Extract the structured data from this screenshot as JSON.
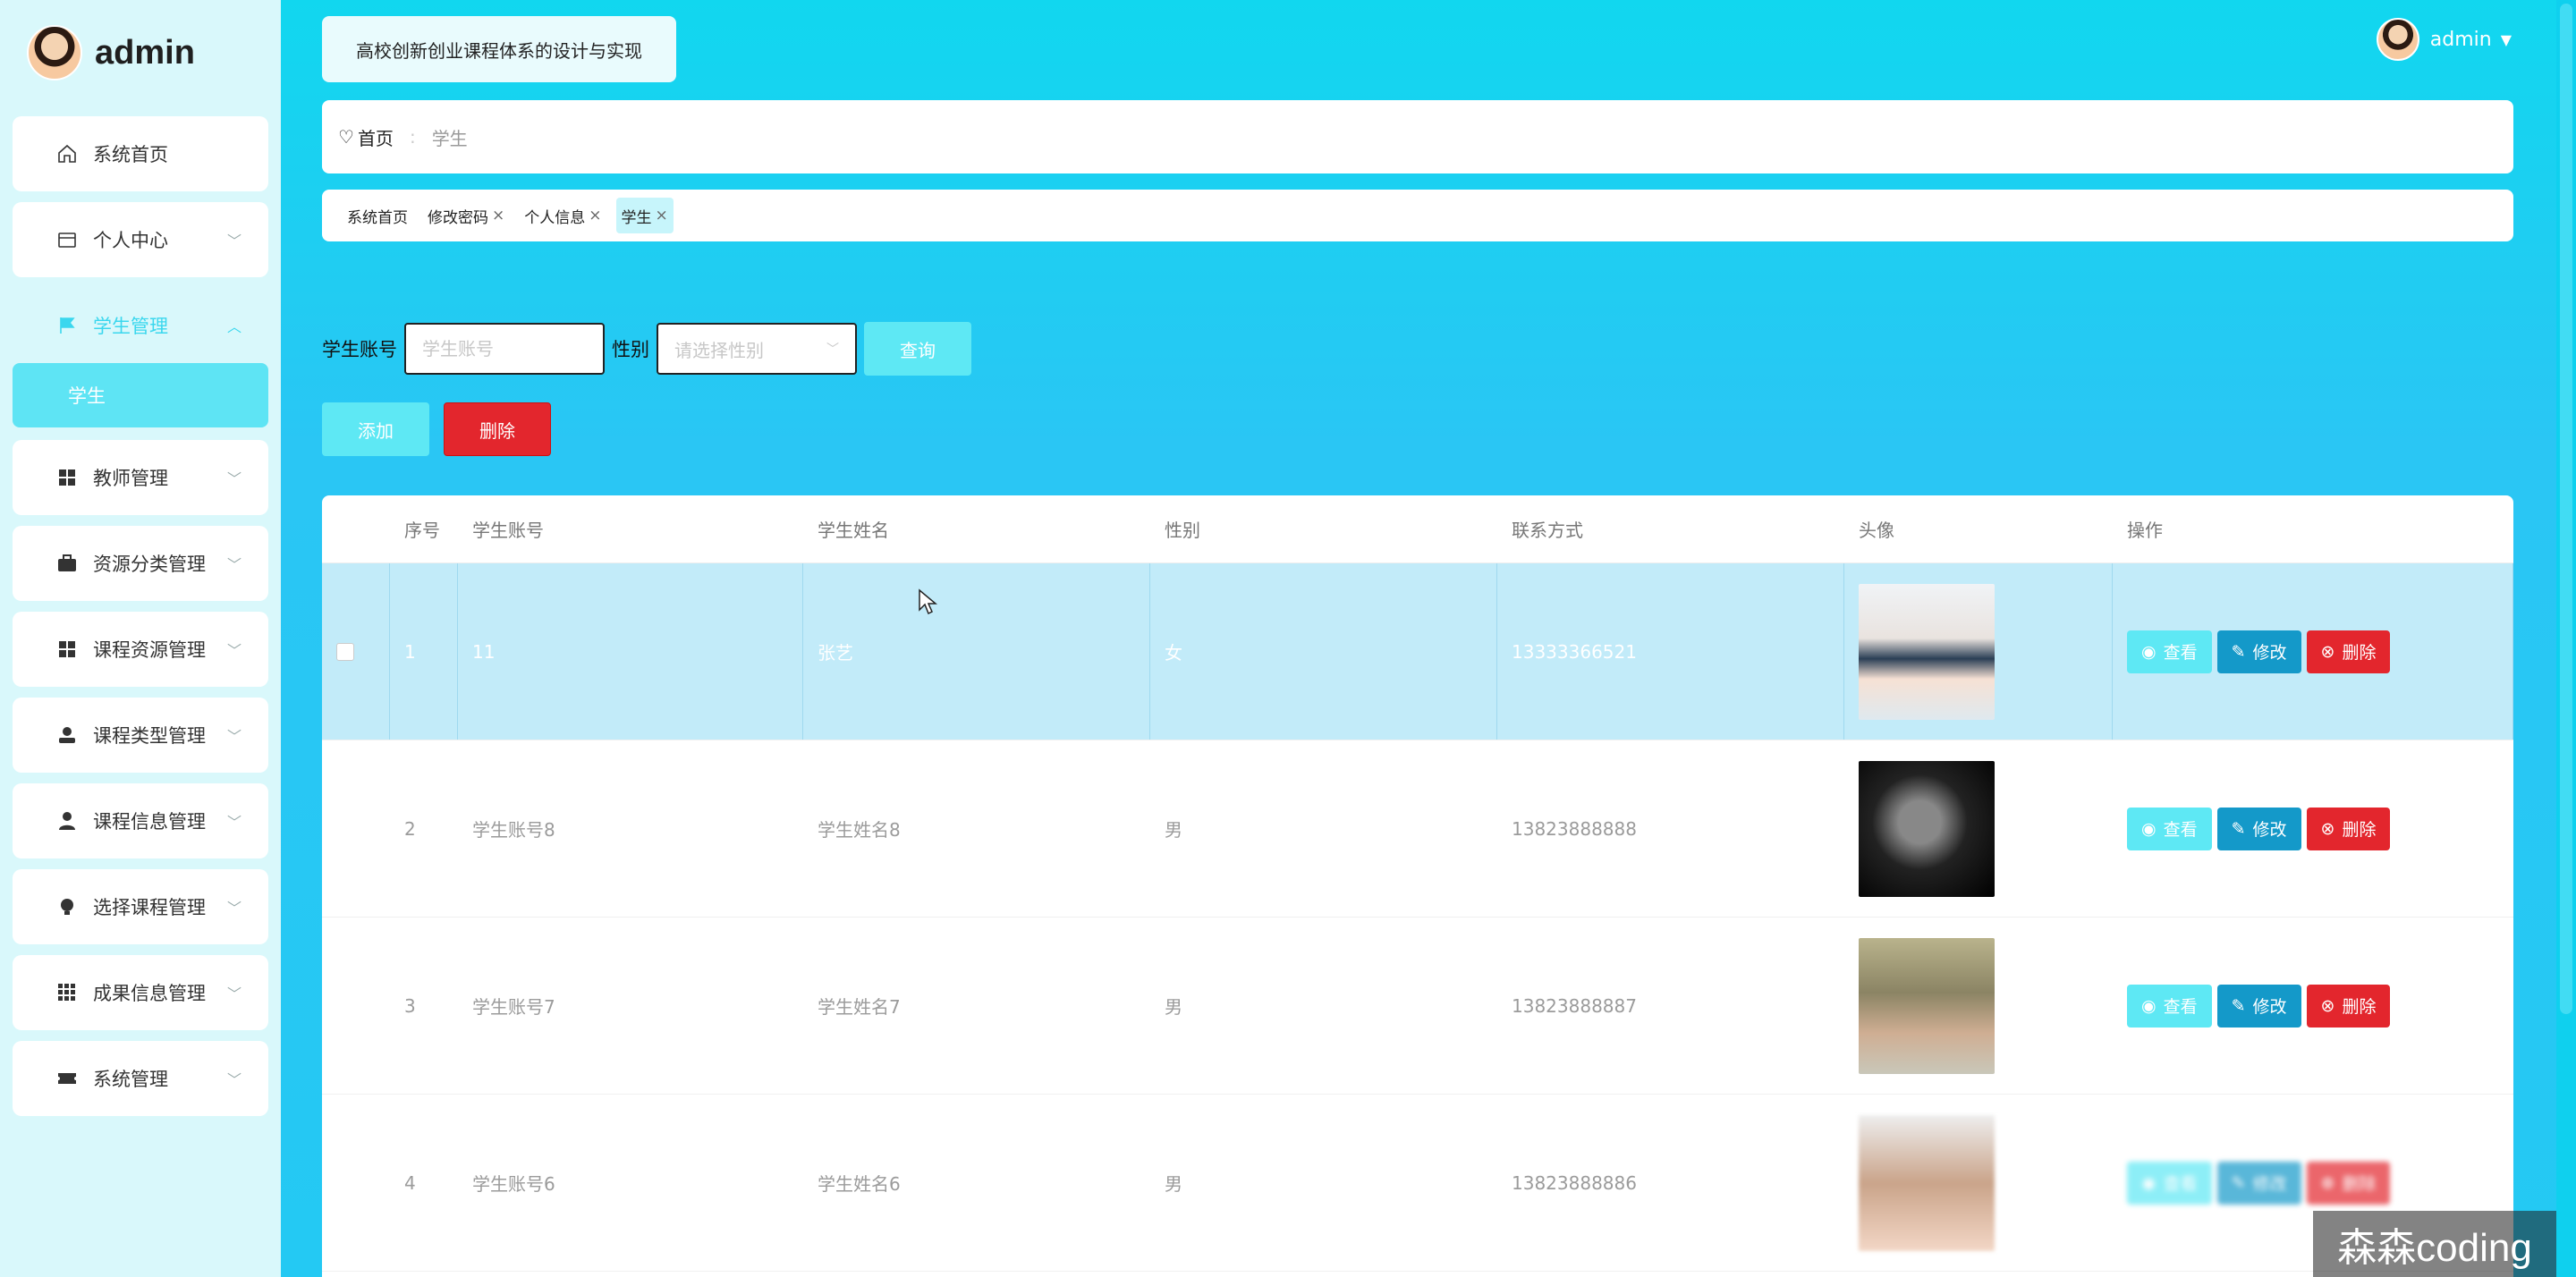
{
  "brand": {
    "name": "admin"
  },
  "sidebar": {
    "items": [
      {
        "label": "系统首页",
        "icon": "home-icon",
        "has_chevron": false
      },
      {
        "label": "个人中心",
        "icon": "calendar-icon",
        "has_chevron": true
      },
      {
        "label": "学生管理",
        "icon": "flag-icon",
        "has_chevron": true,
        "active": true
      },
      {
        "label": "教师管理",
        "icon": "grid-icon",
        "has_chevron": true
      },
      {
        "label": "资源分类管理",
        "icon": "briefcase-icon",
        "has_chevron": true
      },
      {
        "label": "课程资源管理",
        "icon": "grid-icon",
        "has_chevron": true
      },
      {
        "label": "课程类型管理",
        "icon": "person-icon",
        "has_chevron": true
      },
      {
        "label": "课程信息管理",
        "icon": "person-icon",
        "has_chevron": true
      },
      {
        "label": "选择课程管理",
        "icon": "bulb-icon",
        "has_chevron": true
      },
      {
        "label": "成果信息管理",
        "icon": "apps-icon",
        "has_chevron": true
      },
      {
        "label": "系统管理",
        "icon": "ticket-icon",
        "has_chevron": true
      }
    ],
    "submenu_label": "学生"
  },
  "header": {
    "title": "高校创新创业课程体系的设计与实现",
    "user_name": "admin"
  },
  "breadcrumb": {
    "home": "首页",
    "separator": ":",
    "current": "学生"
  },
  "tags": [
    {
      "label": "系统首页",
      "closable": false
    },
    {
      "label": "修改密码",
      "closable": true
    },
    {
      "label": "个人信息",
      "closable": true
    },
    {
      "label": "学生",
      "closable": true,
      "active": true
    }
  ],
  "search": {
    "account_label": "学生账号",
    "account_placeholder": "学生账号",
    "gender_label": "性别",
    "gender_placeholder": "请选择性别",
    "query_button": "查询"
  },
  "actions": {
    "add": "添加",
    "delete": "删除"
  },
  "table": {
    "columns": [
      "序号",
      "学生账号",
      "学生姓名",
      "性别",
      "联系方式",
      "头像",
      "操作"
    ],
    "rows": [
      {
        "no": "1",
        "account": "11",
        "name": "张艺",
        "gender": "女",
        "phone": "13333366521"
      },
      {
        "no": "2",
        "account": "学生账号8",
        "name": "学生姓名8",
        "gender": "男",
        "phone": "13823888888"
      },
      {
        "no": "3",
        "account": "学生账号7",
        "name": "学生姓名7",
        "gender": "男",
        "phone": "13823888887"
      },
      {
        "no": "4",
        "account": "学生账号6",
        "name": "学生姓名6",
        "gender": "男",
        "phone": "13823888886"
      }
    ],
    "op_view": "查看",
    "op_edit": "修改",
    "op_delete": "删除"
  },
  "watermark": "森森coding",
  "colors": {
    "accent": "#5ee8f4",
    "danger": "#e3262d",
    "edit": "#1499c9",
    "gradient_top": "#11d7ef"
  }
}
